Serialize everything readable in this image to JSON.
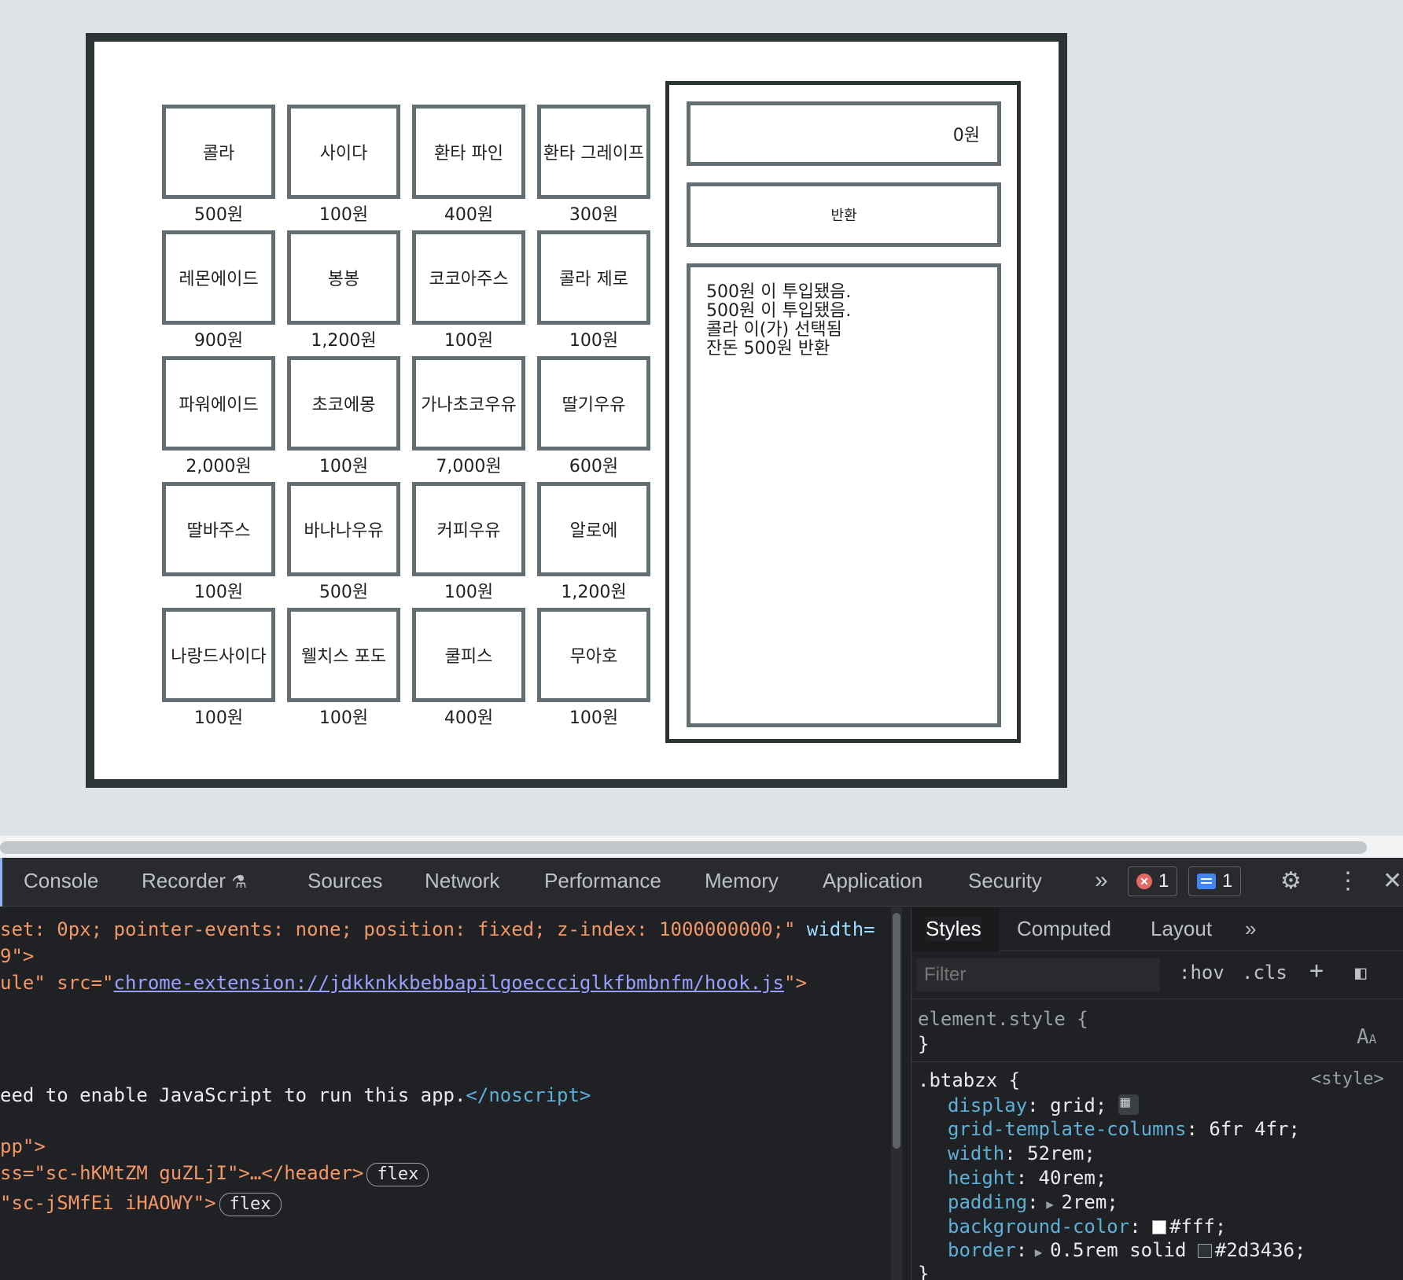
{
  "products": [
    {
      "name": "콜라",
      "price": "500원"
    },
    {
      "name": "사이다",
      "price": "100원"
    },
    {
      "name": "환타 파인",
      "price": "400원"
    },
    {
      "name": "환타 그레이프",
      "price": "300원"
    },
    {
      "name": "레몬에이드",
      "price": "900원"
    },
    {
      "name": "봉봉",
      "price": "1,200원"
    },
    {
      "name": "코코아주스",
      "price": "100원"
    },
    {
      "name": "콜라 제로",
      "price": "100원"
    },
    {
      "name": "파워에이드",
      "price": "2,000원"
    },
    {
      "name": "초코에몽",
      "price": "100원"
    },
    {
      "name": "가나초코우유",
      "price": "7,000원"
    },
    {
      "name": "딸기우유",
      "price": "600원"
    },
    {
      "name": "딸바주스",
      "price": "100원"
    },
    {
      "name": "바나나우유",
      "price": "500원"
    },
    {
      "name": "커피우유",
      "price": "100원"
    },
    {
      "name": "알로에",
      "price": "1,200원"
    },
    {
      "name": "나랑드사이다",
      "price": "100원"
    },
    {
      "name": "웰치스 포도",
      "price": "100원"
    },
    {
      "name": "쿨피스",
      "price": "400원"
    },
    {
      "name": "무아호",
      "price": "100원"
    }
  ],
  "panel": {
    "balance": "0원",
    "return_label": "반환",
    "log": [
      "500원 이 투입됐음.",
      "500원 이 투입됐음.",
      "콜라 이(가) 선택됨",
      "잔돈 500원 반환"
    ]
  },
  "devtools": {
    "tabs": [
      "Console",
      "Recorder",
      "Sources",
      "Network",
      "Performance",
      "Memory",
      "Application",
      "Security"
    ],
    "error_count": "1",
    "message_count": "1",
    "elements_lines": {
      "l1_attr": "set: 0px; pointer-events: none; position: fixed; z-index: 1000000000;\" ",
      "l1_width": "width=",
      "l2": "9\">",
      "l3_pre": "ule\" src=\"",
      "l3_link": "chrome-extension://jdkknkkbebbapilgoeccciglkfbmbnfm/hook.js",
      "l3_post": "\">",
      "l4_text": "eed to enable JavaScript to run this app.",
      "l4_tag": "</noscript>",
      "l5": "pp\">",
      "l6_pre": "ss=\"sc-hKMtZM guZLjI\">…</header>",
      "l6_pill": "flex",
      "l7_pre": "\"sc-jSMfEi iHAOWY\">",
      "l7_pill": "flex"
    },
    "styles_tabs": [
      "Styles",
      "Computed",
      "Layout"
    ],
    "filter_placeholder": "Filter",
    "hov": ":hov",
    "cls": ".cls",
    "element_style": "element.style {",
    "close_brace": "}",
    "selector": ".btabzx {",
    "source": "<style>",
    "props": [
      {
        "name": "display",
        "value": "grid;"
      },
      {
        "name": "grid-template-columns",
        "value": "6fr 4fr;"
      },
      {
        "name": "width",
        "value": "52rem;"
      },
      {
        "name": "height",
        "value": "40rem;"
      },
      {
        "name": "padding",
        "value": "2rem;"
      },
      {
        "name": "background-color",
        "value": "#fff;"
      },
      {
        "name": "border",
        "value": "0.5rem solid #2d3436;"
      }
    ],
    "colors": {
      "swatch_white": "#ffffff",
      "swatch_dark": "#2d3436"
    }
  }
}
